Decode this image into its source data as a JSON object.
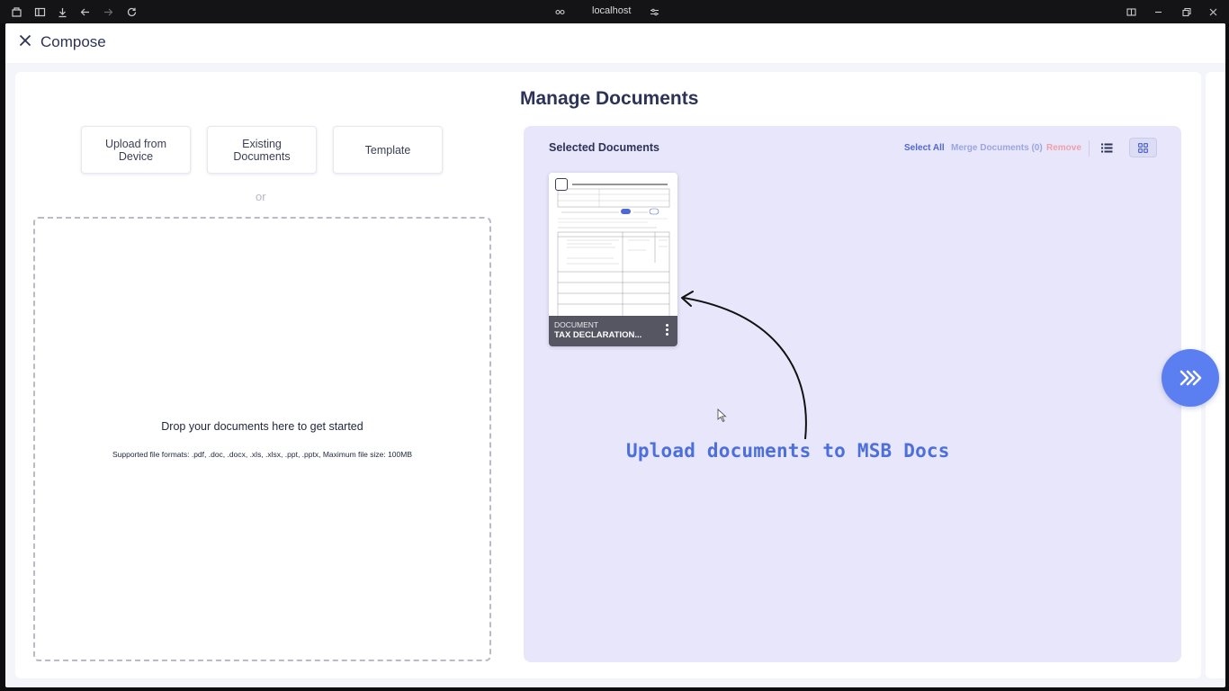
{
  "browser": {
    "url": "localhost"
  },
  "header": {
    "title": "Compose"
  },
  "main": {
    "page_title": "Manage Documents",
    "upload_options": [
      "Upload from Device",
      "Existing Documents",
      "Template"
    ],
    "or_text": "or",
    "dropzone": {
      "title": "Drop your documents here to get started",
      "subtitle": "Supported file formats: .pdf, .doc, .docx, .xls, .xlsx, .ppt, .pptx, Maximum file size: 100MB"
    },
    "selected": {
      "title": "Selected Documents",
      "select_all": "Select All",
      "merge": "Merge Documents (0)",
      "remove": "Remove",
      "view_mode": "grid",
      "documents": [
        {
          "type": "DOCUMENT",
          "name": "TAX DECLARATION..."
        }
      ]
    }
  },
  "annotation": "Upload documents to MSB Docs",
  "colors": {
    "accent": "#5b7ef0",
    "panel": "#e8e6fa",
    "title": "#2c3357",
    "remove": "#f0a0a9"
  }
}
